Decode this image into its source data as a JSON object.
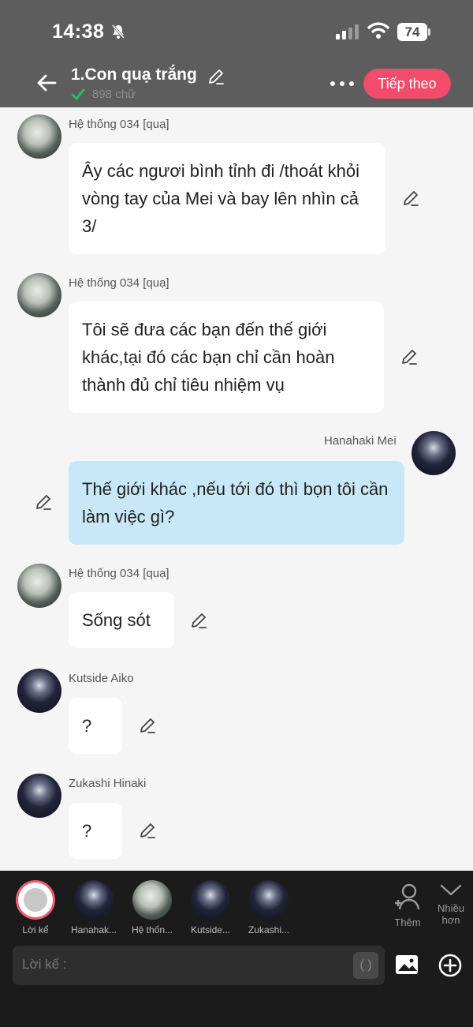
{
  "status_bar": {
    "time": "14:38",
    "battery": "74"
  },
  "header": {
    "title": "1.Con quạ trắng",
    "word_count": "898 chữ",
    "next_label": "Tiếp theo"
  },
  "messages": [
    {
      "sender": "Hệ thống 034 [quạ]",
      "text": "Ây các ngươi bình tỉnh đi /thoát khỏi vòng tay của Mei và bay lên nhìn cả 3/",
      "mine": false
    },
    {
      "sender": "Hệ thống 034 [quạ]",
      "text": "Tôi sẽ đưa các bạn đến thế giới khác,tại đó các bạn chỉ cần hoàn thành đủ chỉ tiêu nhiệm vụ",
      "mine": false
    },
    {
      "sender": "Hanahaki Mei",
      "text": "Thế giới khác ,nếu tới đó thì bọn tôi cần làm việc gì?",
      "mine": true
    },
    {
      "sender": "Hệ thống 034 [quạ]",
      "text": "Sống sót",
      "mine": false
    },
    {
      "sender": "Kutside Aiko",
      "text": "?",
      "mine": false
    },
    {
      "sender": "Zukashi Hinaki",
      "text": "?",
      "mine": false
    }
  ],
  "characters": [
    {
      "label": "Lời kể"
    },
    {
      "label": "Hanahak..."
    },
    {
      "label": "Hệ thốn..."
    },
    {
      "label": "Kutside..."
    },
    {
      "label": "Zukashi..."
    }
  ],
  "actions": {
    "add_label": "Thêm",
    "more_label_1": "Nhiều",
    "more_label_2": "hơn"
  },
  "composer": {
    "placeholder": "Lời kể :",
    "paren_label": "( )"
  },
  "colors": {
    "accent": "#f24b6b",
    "header_bg": "#5d5d5d",
    "mine_bubble": "#c8e8f8",
    "bottom_bg": "#1b1b1b"
  }
}
